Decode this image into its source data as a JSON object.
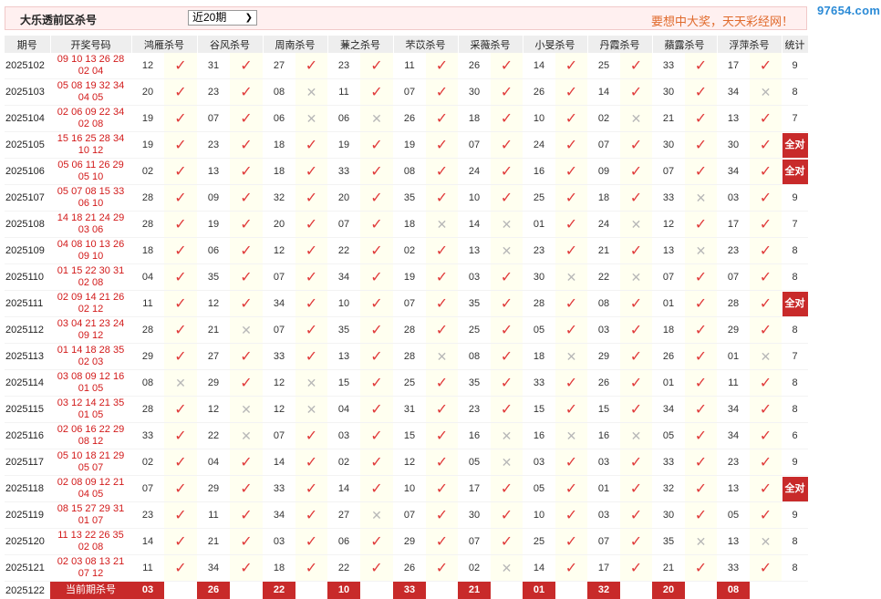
{
  "header": {
    "title": "大乐透前区杀号",
    "select_value": "近20期",
    "slogan": "要想中大奖，天天彩经网！",
    "logo": "97654.com"
  },
  "columns": {
    "period": "期号",
    "draw": "开奖号码",
    "experts": [
      "鸿雁杀号",
      "谷风杀号",
      "周南杀号",
      "蒹之杀号",
      "芣苡杀号",
      "采薇杀号",
      "小旻杀号",
      "丹霞杀号",
      "蘋露杀号",
      "浮萍杀号"
    ],
    "count": "统计"
  },
  "rows": [
    {
      "period": "2025102",
      "draw_front": "09 10 13 26 28",
      "draw_back": "02 04",
      "kills": [
        "12",
        "31",
        "27",
        "23",
        "11",
        "26",
        "14",
        "25",
        "33",
        "17"
      ],
      "ok": [
        1,
        1,
        1,
        1,
        1,
        1,
        1,
        1,
        1,
        1
      ],
      "count": "9"
    },
    {
      "period": "2025103",
      "draw_front": "05 08 19 32 34",
      "draw_back": "04 05",
      "kills": [
        "20",
        "23",
        "08",
        "11",
        "07",
        "30",
        "26",
        "14",
        "30",
        "34"
      ],
      "ok": [
        1,
        1,
        0,
        1,
        1,
        1,
        1,
        1,
        1,
        0
      ],
      "count": "8"
    },
    {
      "period": "2025104",
      "draw_front": "02 06 09 22 34",
      "draw_back": "02 08",
      "kills": [
        "19",
        "07",
        "06",
        "06",
        "26",
        "18",
        "10",
        "02",
        "21",
        "13"
      ],
      "ok": [
        1,
        1,
        0,
        0,
        1,
        1,
        1,
        0,
        1,
        1
      ],
      "count": "7"
    },
    {
      "period": "2025105",
      "draw_front": "15 16 25 28 34",
      "draw_back": "10 12",
      "kills": [
        "19",
        "23",
        "18",
        "19",
        "19",
        "07",
        "24",
        "07",
        "30",
        "30"
      ],
      "ok": [
        1,
        1,
        1,
        1,
        1,
        1,
        1,
        1,
        1,
        1
      ],
      "count": "全对"
    },
    {
      "period": "2025106",
      "draw_front": "05 06 11 26 29",
      "draw_back": "05 10",
      "kills": [
        "02",
        "13",
        "18",
        "33",
        "08",
        "24",
        "16",
        "09",
        "07",
        "34"
      ],
      "ok": [
        1,
        1,
        1,
        1,
        1,
        1,
        1,
        1,
        1,
        1
      ],
      "count": "全对"
    },
    {
      "period": "2025107",
      "draw_front": "05 07 08 15 33",
      "draw_back": "06 10",
      "kills": [
        "28",
        "09",
        "32",
        "20",
        "35",
        "10",
        "25",
        "18",
        "33",
        "03"
      ],
      "ok": [
        1,
        1,
        1,
        1,
        1,
        1,
        1,
        1,
        0,
        1
      ],
      "count": "9"
    },
    {
      "period": "2025108",
      "draw_front": "14 18 21 24 29",
      "draw_back": "03 06",
      "kills": [
        "28",
        "19",
        "20",
        "07",
        "18",
        "14",
        "01",
        "24",
        "12",
        "17"
      ],
      "ok": [
        1,
        1,
        1,
        1,
        0,
        0,
        1,
        0,
        1,
        1
      ],
      "count": "7"
    },
    {
      "period": "2025109",
      "draw_front": "04 08 10 13 26",
      "draw_back": "09 10",
      "kills": [
        "18",
        "06",
        "12",
        "22",
        "02",
        "13",
        "23",
        "21",
        "13",
        "23"
      ],
      "ok": [
        1,
        1,
        1,
        1,
        1,
        0,
        1,
        1,
        0,
        1
      ],
      "count": "8"
    },
    {
      "period": "2025110",
      "draw_front": "01 15 22 30 31",
      "draw_back": "02 08",
      "kills": [
        "04",
        "35",
        "07",
        "34",
        "19",
        "03",
        "30",
        "22",
        "07",
        "07"
      ],
      "ok": [
        1,
        1,
        1,
        1,
        1,
        1,
        0,
        0,
        1,
        1
      ],
      "count": "8"
    },
    {
      "period": "2025111",
      "draw_front": "02 09 14 21 26",
      "draw_back": "02 12",
      "kills": [
        "11",
        "12",
        "34",
        "10",
        "07",
        "35",
        "28",
        "08",
        "01",
        "28"
      ],
      "ok": [
        1,
        1,
        1,
        1,
        1,
        1,
        1,
        1,
        1,
        1
      ],
      "count": "全对"
    },
    {
      "period": "2025112",
      "draw_front": "03 04 21 23 24",
      "draw_back": "09 12",
      "kills": [
        "28",
        "21",
        "07",
        "35",
        "28",
        "25",
        "05",
        "03",
        "18",
        "29"
      ],
      "ok": [
        1,
        0,
        1,
        1,
        1,
        1,
        1,
        1,
        1,
        1
      ],
      "count": "8"
    },
    {
      "period": "2025113",
      "draw_front": "01 14 18 28 35",
      "draw_back": "02 03",
      "kills": [
        "29",
        "27",
        "33",
        "13",
        "28",
        "08",
        "18",
        "29",
        "26",
        "01"
      ],
      "ok": [
        1,
        1,
        1,
        1,
        0,
        1,
        0,
        1,
        1,
        0
      ],
      "count": "7"
    },
    {
      "period": "2025114",
      "draw_front": "03 08 09 12 16",
      "draw_back": "01 05",
      "kills": [
        "08",
        "29",
        "12",
        "15",
        "25",
        "35",
        "33",
        "26",
        "01",
        "11"
      ],
      "ok": [
        0,
        1,
        0,
        1,
        1,
        1,
        1,
        1,
        1,
        1
      ],
      "count": "8"
    },
    {
      "period": "2025115",
      "draw_front": "03 12 14 21 35",
      "draw_back": "01 05",
      "kills": [
        "28",
        "12",
        "12",
        "04",
        "31",
        "23",
        "15",
        "15",
        "34",
        "34"
      ],
      "ok": [
        1,
        0,
        0,
        1,
        1,
        1,
        1,
        1,
        1,
        1
      ],
      "count": "8"
    },
    {
      "period": "2025116",
      "draw_front": "02 06 16 22 29",
      "draw_back": "08 12",
      "kills": [
        "33",
        "22",
        "07",
        "03",
        "15",
        "16",
        "16",
        "16",
        "05",
        "34"
      ],
      "ok": [
        1,
        0,
        1,
        1,
        1,
        0,
        0,
        0,
        1,
        1
      ],
      "count": "6"
    },
    {
      "period": "2025117",
      "draw_front": "05 10 18 21 29",
      "draw_back": "05 07",
      "kills": [
        "02",
        "04",
        "14",
        "02",
        "12",
        "05",
        "03",
        "03",
        "33",
        "23"
      ],
      "ok": [
        1,
        1,
        1,
        1,
        1,
        0,
        1,
        1,
        1,
        1
      ],
      "count": "9"
    },
    {
      "period": "2025118",
      "draw_front": "02 08 09 12 21",
      "draw_back": "04 05",
      "kills": [
        "07",
        "29",
        "33",
        "14",
        "10",
        "17",
        "05",
        "01",
        "32",
        "13"
      ],
      "ok": [
        1,
        1,
        1,
        1,
        1,
        1,
        1,
        1,
        1,
        1
      ],
      "count": "全对"
    },
    {
      "period": "2025119",
      "draw_front": "08 15 27 29 31",
      "draw_back": "01 07",
      "kills": [
        "23",
        "11",
        "34",
        "27",
        "07",
        "30",
        "10",
        "03",
        "30",
        "05"
      ],
      "ok": [
        1,
        1,
        1,
        0,
        1,
        1,
        1,
        1,
        1,
        1
      ],
      "count": "9"
    },
    {
      "period": "2025120",
      "draw_front": "11 13 22 26 35",
      "draw_back": "02 08",
      "kills": [
        "14",
        "21",
        "03",
        "06",
        "29",
        "07",
        "25",
        "07",
        "35",
        "13"
      ],
      "ok": [
        1,
        1,
        1,
        1,
        1,
        1,
        1,
        1,
        0,
        0
      ],
      "count": "8"
    },
    {
      "period": "2025121",
      "draw_front": "02 03 08 13 21",
      "draw_back": "07 12",
      "kills": [
        "11",
        "34",
        "18",
        "22",
        "26",
        "02",
        "14",
        "17",
        "21",
        "33"
      ],
      "ok": [
        1,
        1,
        1,
        1,
        1,
        0,
        1,
        1,
        1,
        1
      ],
      "count": "8"
    }
  ],
  "current": {
    "period": "2025122",
    "label": "当前期杀号",
    "kills": [
      "03",
      "26",
      "22",
      "10",
      "33",
      "21",
      "01",
      "32",
      "20",
      "08"
    ]
  }
}
